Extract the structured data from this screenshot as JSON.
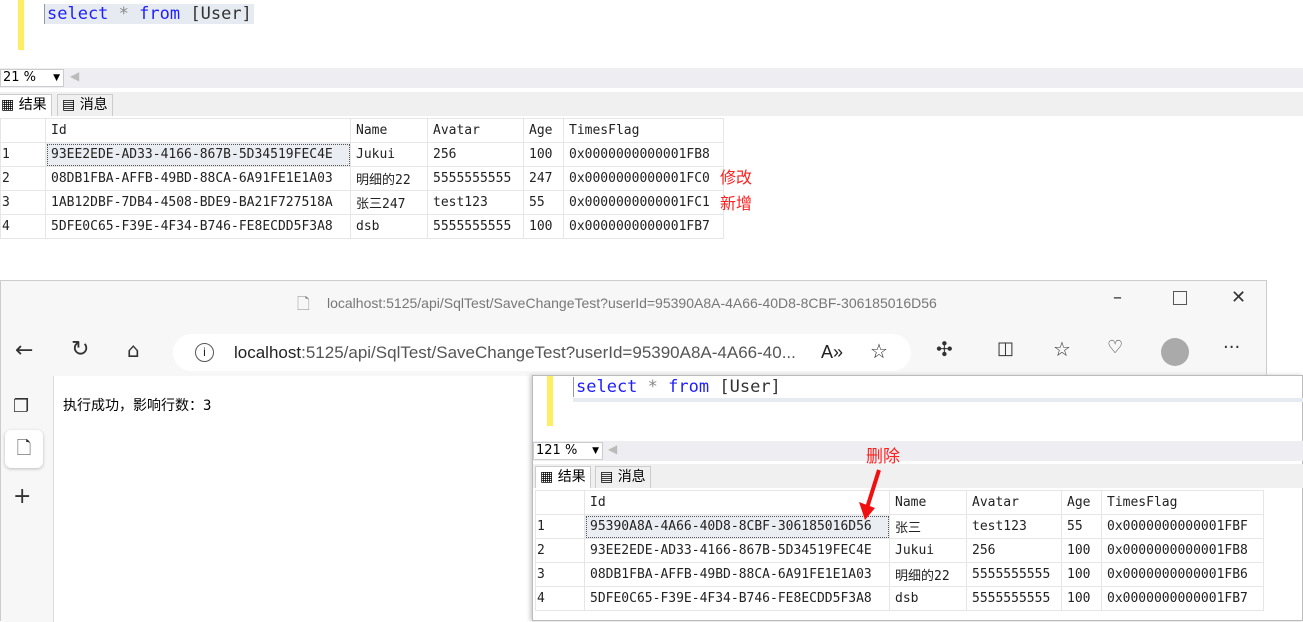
{
  "top_query": {
    "kw1": "select",
    "op": "*",
    "kw2": "from",
    "table": "[User]"
  },
  "top_zoom": "21 %",
  "tabs": {
    "results": "结果",
    "messages": "消息"
  },
  "columns": [
    "Id",
    "Name",
    "Avatar",
    "Age",
    "TimesFlag"
  ],
  "top_rows": [
    [
      "1",
      "93EE2EDE-AD33-4166-867B-5D34519FEC4E",
      "Jukui",
      "256",
      "100",
      "0x0000000000001FB8"
    ],
    [
      "2",
      "08DB1FBA-AFFB-49BD-88CA-6A91FE1E1A03",
      "明细的22",
      "5555555555",
      "247",
      "0x0000000000001FC0"
    ],
    [
      "3",
      "1AB12DBF-7DB4-4508-BDE9-BA21F727518A",
      "张三247",
      "test123",
      "55",
      "0x0000000000001FC1"
    ],
    [
      "4",
      "5DFE0C65-F39E-4F34-B746-FE8ECDD5F3A8",
      "dsb",
      "5555555555",
      "100",
      "0x0000000000001FB7"
    ]
  ],
  "annotations": {
    "modified": "修改",
    "added": "新增",
    "deleted": "删除"
  },
  "browser": {
    "title": "localhost:5125/api/SqlTest/SaveChangeTest?userId=95390A8A-4A66-40D8-8CBF-306185016D56",
    "address_host": "localhost",
    "address_rest": ":5125/api/SqlTest/SaveChangeTest?userId=95390A8A-4A66-40...",
    "page_text": "执行成功，影响行数：3"
  },
  "bottom_zoom": "121 %",
  "bottom_rows": [
    [
      "1",
      "95390A8A-4A66-40D8-8CBF-306185016D56",
      "张三",
      "test123",
      "55",
      "0x0000000000001FBF"
    ],
    [
      "2",
      "93EE2EDE-AD33-4166-867B-5D34519FEC4E",
      "Jukui",
      "256",
      "100",
      "0x0000000000001FB8"
    ],
    [
      "3",
      "08DB1FBA-AFFB-49BD-88CA-6A91FE1E1A03",
      "明细的22",
      "5555555555",
      "100",
      "0x0000000000001FB6"
    ],
    [
      "4",
      "5DFE0C65-F39E-4F34-B746-FE8ECDD5F3A8",
      "dsb",
      "5555555555",
      "100",
      "0x0000000000001FB7"
    ]
  ]
}
